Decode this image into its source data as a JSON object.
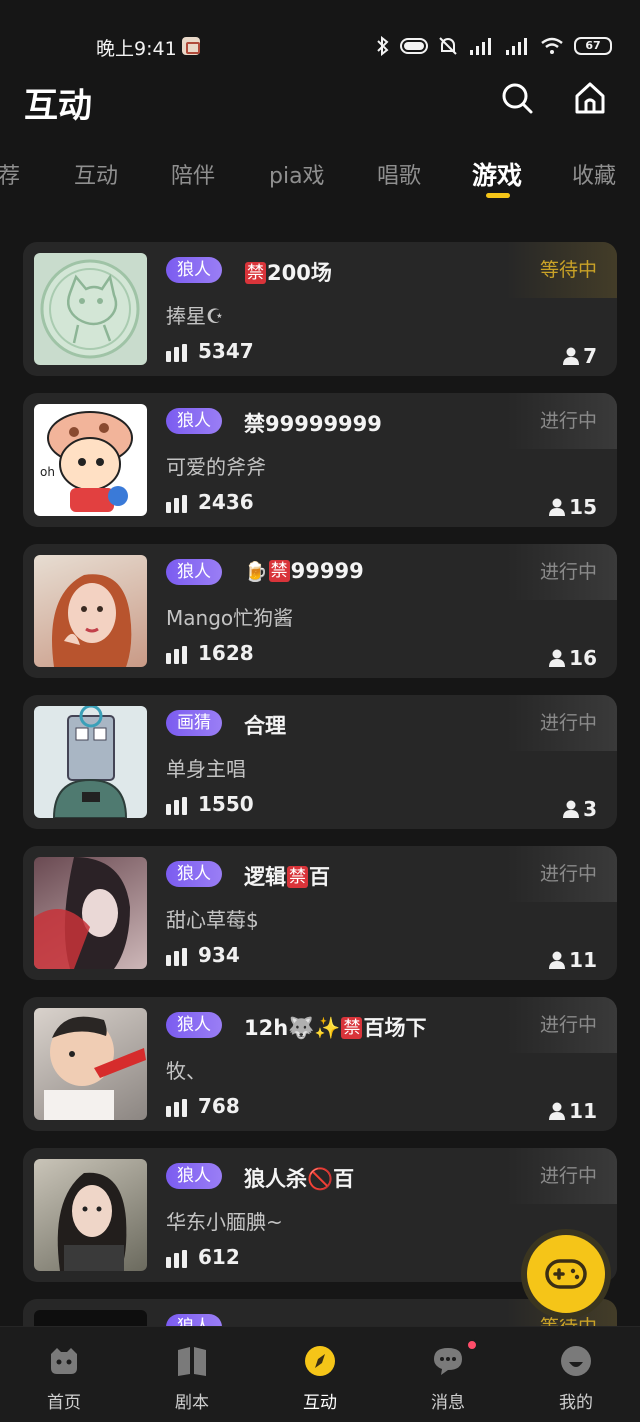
{
  "status_bar": {
    "time": "晚上9:41",
    "battery": "67"
  },
  "header": {
    "title": "互动",
    "search_icon": "search-icon",
    "home_icon": "home-icon"
  },
  "tabs": [
    {
      "label": "荐",
      "active": false
    },
    {
      "label": "互动",
      "active": false
    },
    {
      "label": "陪伴",
      "active": false
    },
    {
      "label": "pia戏",
      "active": false
    },
    {
      "label": "唱歌",
      "active": false
    },
    {
      "label": "游戏",
      "active": true
    },
    {
      "label": "收藏",
      "active": false
    }
  ],
  "colors": {
    "accent": "#f5c518",
    "tag_purple": "#7b5cf0",
    "ban_red": "#d9343a",
    "background": "#161616",
    "card": "#272727"
  },
  "rooms": [
    {
      "tag": "狼人",
      "name_parts": [
        "",
        "禁",
        "200场"
      ],
      "host": "捧星☪",
      "heat": "5347",
      "status": "等待中",
      "people": "7"
    },
    {
      "tag": "狼人",
      "name_parts": [
        "",
        "禁",
        "99999999"
      ],
      "host": "可爱的斧斧",
      "heat": "2436",
      "status": "进行中",
      "people": "15"
    },
    {
      "tag": "狼人",
      "name_parts": [
        "🍺",
        "禁",
        "99999"
      ],
      "host": "Mango忙狗酱",
      "heat": "1628",
      "status": "进行中",
      "people": "16"
    },
    {
      "tag": "画猜",
      "name_parts": [
        "合理",
        "",
        ""
      ],
      "host": "单身主唱",
      "heat": "1550",
      "status": "进行中",
      "people": "3"
    },
    {
      "tag": "狼人",
      "name_parts": [
        "逻辑",
        "禁",
        "百"
      ],
      "host": "甜心草莓$",
      "heat": "934",
      "status": "进行中",
      "people": "11"
    },
    {
      "tag": "狼人",
      "name_parts": [
        "12h🐺✨",
        "禁",
        "百场下"
      ],
      "host": "牧、",
      "heat": "768",
      "status": "进行中",
      "people": "11"
    },
    {
      "tag": "狼人",
      "name_parts": [
        "狼人杀🚫百",
        "",
        ""
      ],
      "host": "华东小腼腆~",
      "heat": "612",
      "status": "进行中",
      "people": ""
    },
    {
      "tag": "狼人",
      "name_parts": [
        "",
        "",
        ""
      ],
      "host": "",
      "heat": "",
      "status": "等待中",
      "people": ""
    }
  ],
  "bottom_nav": [
    {
      "label": "首页",
      "icon": "game-controller-face-icon",
      "active": false
    },
    {
      "label": "剧本",
      "icon": "book-icon",
      "active": false
    },
    {
      "label": "互动",
      "icon": "compass-icon",
      "active": true
    },
    {
      "label": "消息",
      "icon": "chat-bubble-icon",
      "active": false
    },
    {
      "label": "我的",
      "icon": "profile-face-icon",
      "active": false
    }
  ],
  "fab": {
    "icon": "gamepad-icon"
  }
}
